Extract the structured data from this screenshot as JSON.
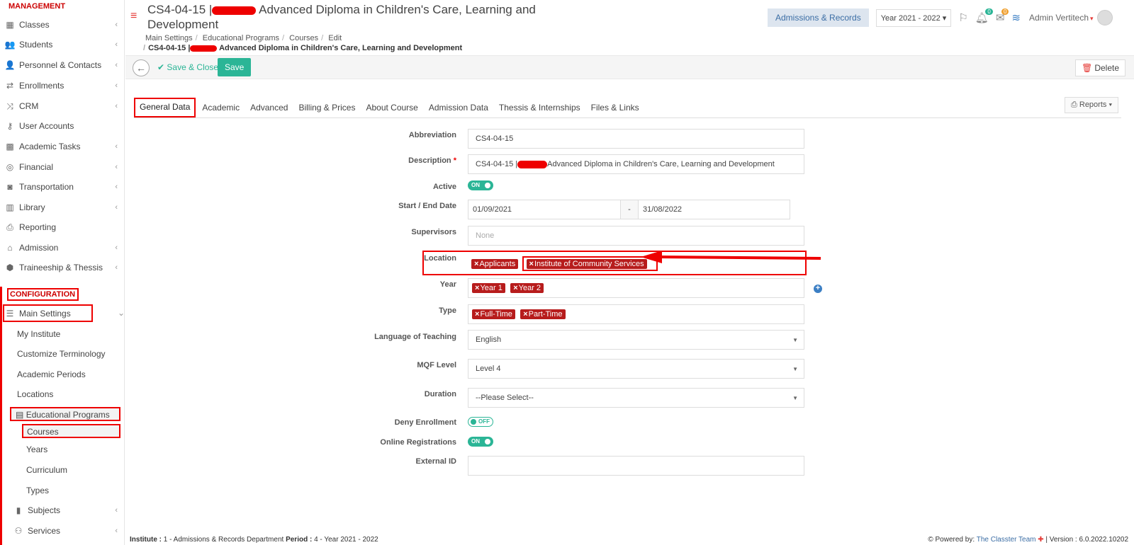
{
  "sidebar": {
    "management_header": "MANAGEMENT",
    "configuration_header": "CONFIGURATION",
    "management_items": [
      {
        "label": "Classes",
        "icon": "classes-icon"
      },
      {
        "label": "Students",
        "icon": "students-icon"
      },
      {
        "label": "Personnel & Contacts",
        "icon": "personnel-icon"
      },
      {
        "label": "Enrollments",
        "icon": "enrollments-icon"
      },
      {
        "label": "CRM",
        "icon": "crm-icon"
      },
      {
        "label": "User Accounts",
        "icon": "key-icon"
      },
      {
        "label": "Academic Tasks",
        "icon": "tasks-icon"
      },
      {
        "label": "Financial",
        "icon": "coins-icon"
      },
      {
        "label": "Transportation",
        "icon": "bus-icon"
      },
      {
        "label": "Library",
        "icon": "library-icon"
      },
      {
        "label": "Reporting",
        "icon": "printer-icon"
      },
      {
        "label": "Admission",
        "icon": "institution-icon"
      },
      {
        "label": "Traineeship & Thessis",
        "icon": "box-icon"
      }
    ],
    "main_settings": "Main Settings",
    "main_settings_children": [
      "My Institute",
      "Customize Terminology",
      "Academic Periods",
      "Locations"
    ],
    "educational_programs": "Educational Programs",
    "edu_children": [
      "Courses",
      "Years",
      "Curriculum",
      "Types"
    ],
    "subjects": "Subjects",
    "services": "Services"
  },
  "header": {
    "title_code": "CS4-04-15 |",
    "title_rest": "Advanced Diploma in Children's Care, Learning and Development",
    "breadcrumb": [
      "Main Settings",
      "Educational Programs",
      "Courses",
      "Edit"
    ],
    "breadcrumb_current_code": "CS4-04-15 |",
    "breadcrumb_current_rest": "Advanced Diploma in Children's Care, Learning and Development",
    "admissions_btn": "Admissions & Records",
    "year_select": "Year 2021 - 2022",
    "notif_count": "0",
    "mail_count": "0",
    "admin_name": "Admin Vertitech"
  },
  "toolbar": {
    "save_close": "Save & Close",
    "save": "Save",
    "delete": "Delete"
  },
  "tabs": [
    "General Data",
    "Academic",
    "Advanced",
    "Billing & Prices",
    "About Course",
    "Admission Data",
    "Thessis & Internships",
    "Files & Links"
  ],
  "reports_btn": "Reports",
  "form": {
    "abbreviation_label": "Abbreviation",
    "abbreviation_value": "CS4-04-15",
    "description_label": "Description",
    "description_code": "CS4-04-15 |",
    "description_rest": "Advanced Diploma in Children's Care, Learning and Development",
    "active_label": "Active",
    "active_state": "ON",
    "dates_label": "Start / End Date",
    "start_date": "01/09/2021",
    "date_sep": "-",
    "end_date": "31/08/2022",
    "supervisors_label": "Supervisors",
    "supervisors_placeholder": "None",
    "location_label": "Location",
    "location_tags": [
      "Applicants",
      "Institute of Community Services"
    ],
    "year_label": "Year",
    "year_tags": [
      "Year 1",
      "Year 2"
    ],
    "type_label": "Type",
    "type_tags": [
      "Full-Time",
      "Part-Time"
    ],
    "language_label": "Language of Teaching",
    "language_value": "English",
    "mqf_label": "MQF Level",
    "mqf_value": "Level 4",
    "duration_label": "Duration",
    "duration_value": "--Please Select--",
    "deny_label": "Deny Enrollment",
    "deny_state": "OFF",
    "online_label": "Online Registrations",
    "online_state": "ON",
    "external_label": "External ID",
    "external_value": ""
  },
  "footer": {
    "institute_key": "Institute :",
    "institute_val": "1 - Admissions & Records Department",
    "period_key": "Period :",
    "period_val": "4 - Year 2021 - 2022",
    "powered": "Powered by:",
    "powered_link": "The Classter Team",
    "version": "| Version : 6.0.2022.10202"
  },
  "colors": {
    "accent": "#2bb596",
    "tag": "#b71c1c",
    "highlight": "#ee0000"
  }
}
